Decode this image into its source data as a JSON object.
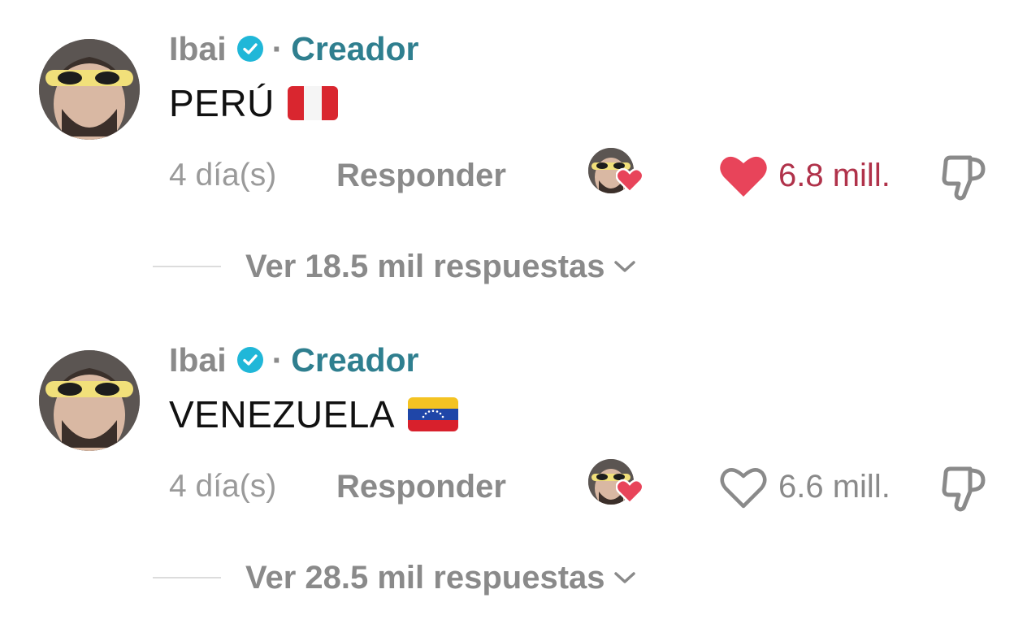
{
  "comments": [
    {
      "username": "Ibai",
      "separator": "·",
      "creator_label": "Creador",
      "text": "PERÚ",
      "flag": "peru-flag",
      "time": "4 día(s)",
      "reply_label": "Responder",
      "likes": "6.8 mill.",
      "liked": true,
      "replies_label": "Ver 18.5 mil respuestas"
    },
    {
      "username": "Ibai",
      "separator": "·",
      "creator_label": "Creador",
      "text": "VENEZUELA",
      "flag": "venezuela-flag",
      "time": "4 día(s)",
      "reply_label": "Responder",
      "likes": "6.6 mill.",
      "liked": false,
      "replies_label": "Ver 28.5 mil respuestas"
    }
  ],
  "colors": {
    "creator": "#2f7f8f",
    "verified": "#20b7d8",
    "like_active": "#e8445a",
    "muted": "#8a8a8a"
  }
}
